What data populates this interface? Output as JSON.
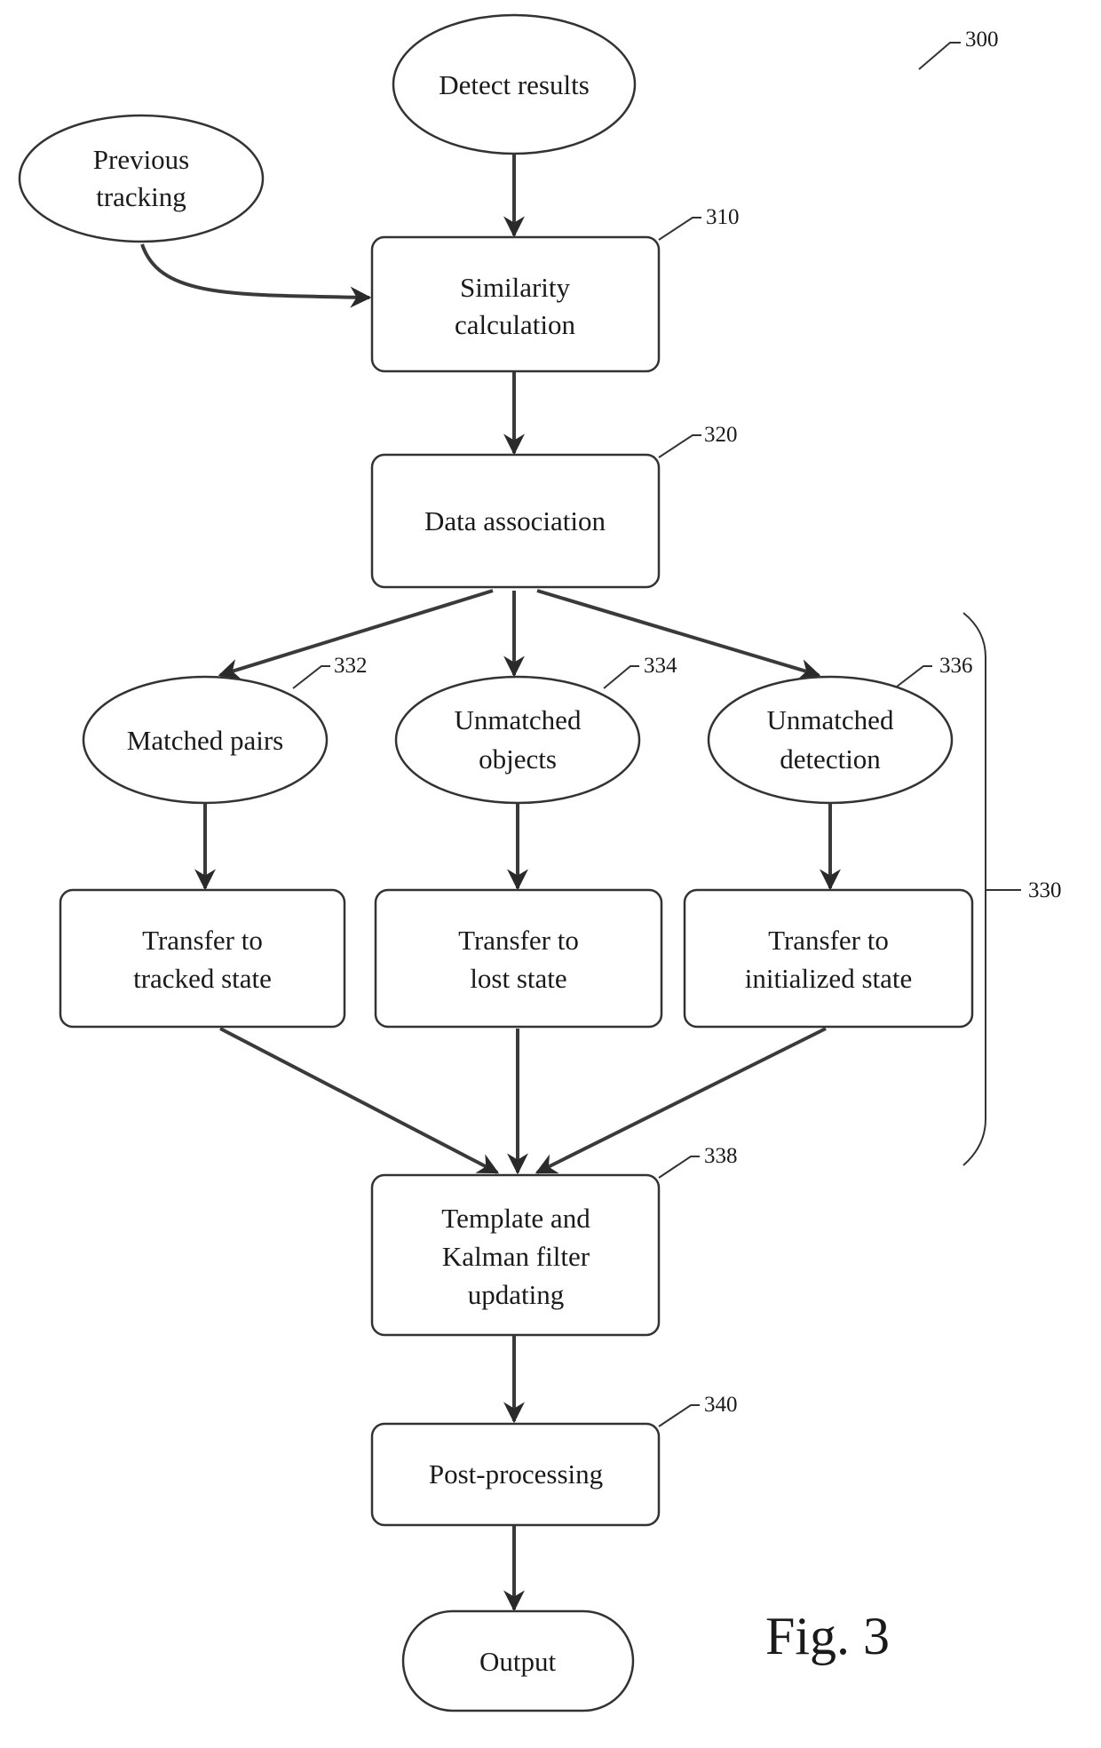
{
  "figure": {
    "label": "Fig. 3",
    "reference": "300"
  },
  "nodes": {
    "detect_results": {
      "lines": [
        "Detect results"
      ]
    },
    "previous_tracking": {
      "lines": [
        "Previous",
        "tracking"
      ]
    },
    "similarity": {
      "lines": [
        "Similarity",
        "calculation"
      ],
      "ref": "310"
    },
    "data_association": {
      "lines": [
        "Data association"
      ],
      "ref": "320"
    },
    "matched_pairs": {
      "lines": [
        "Matched pairs"
      ],
      "ref": "332"
    },
    "unmatched_objects": {
      "lines": [
        "Unmatched",
        "objects"
      ],
      "ref": "334"
    },
    "unmatched_detection": {
      "lines": [
        "Unmatched",
        "detection"
      ],
      "ref": "336"
    },
    "transfer_tracked": {
      "lines": [
        "Transfer to",
        "tracked state"
      ]
    },
    "transfer_lost": {
      "lines": [
        "Transfer to",
        "lost state"
      ]
    },
    "transfer_initialized": {
      "lines": [
        "Transfer to",
        "initialized state"
      ]
    },
    "template_kalman": {
      "lines": [
        "Template and",
        "Kalman filter",
        "updating"
      ],
      "ref": "338"
    },
    "post_processing": {
      "lines": [
        "Post-processing"
      ],
      "ref": "340"
    },
    "output": {
      "lines": [
        "Output"
      ]
    }
  },
  "group": {
    "ref": "330"
  },
  "edges": [
    {
      "from": "detect_results",
      "to": "similarity"
    },
    {
      "from": "previous_tracking",
      "to": "similarity"
    },
    {
      "from": "similarity",
      "to": "data_association"
    },
    {
      "from": "data_association",
      "to": "matched_pairs"
    },
    {
      "from": "data_association",
      "to": "unmatched_objects"
    },
    {
      "from": "data_association",
      "to": "unmatched_detection"
    },
    {
      "from": "matched_pairs",
      "to": "transfer_tracked"
    },
    {
      "from": "unmatched_objects",
      "to": "transfer_lost"
    },
    {
      "from": "unmatched_detection",
      "to": "transfer_initialized"
    },
    {
      "from": "transfer_tracked",
      "to": "template_kalman"
    },
    {
      "from": "transfer_lost",
      "to": "template_kalman"
    },
    {
      "from": "transfer_initialized",
      "to": "template_kalman"
    },
    {
      "from": "template_kalman",
      "to": "post_processing"
    },
    {
      "from": "post_processing",
      "to": "output"
    }
  ]
}
